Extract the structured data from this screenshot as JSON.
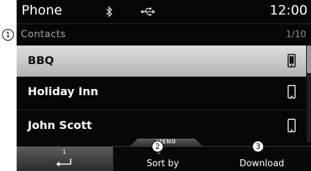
{
  "status_bar": {
    "app_title": "Phone",
    "time": "12:00",
    "icons": [
      "bluetooth-icon",
      "usb-icon"
    ]
  },
  "contacts_header": {
    "label": "Contacts",
    "page_indicator": "1/10"
  },
  "contacts": [
    {
      "name": "BBQ",
      "selected": true,
      "icon": "mobile-phone-icon"
    },
    {
      "name": "Holiday Inn",
      "selected": false,
      "icon": "mobile-phone-icon"
    },
    {
      "name": "John Scott",
      "selected": false,
      "icon": "mobile-phone-icon"
    }
  ],
  "menu_tab": {
    "label": "MENU"
  },
  "bottom_bar": {
    "back": {
      "number": "1",
      "icon": "back-arrow-icon"
    },
    "sort_by": {
      "number": "2",
      "label": "Sort by"
    },
    "download": {
      "label": "Download"
    }
  },
  "callouts": [
    "1",
    "2",
    "3"
  ],
  "colors": {
    "screen_background": "#060606",
    "selected_row": "#c7c7c7",
    "text": "#ffffff",
    "muted_text": "#a5a5a5"
  }
}
